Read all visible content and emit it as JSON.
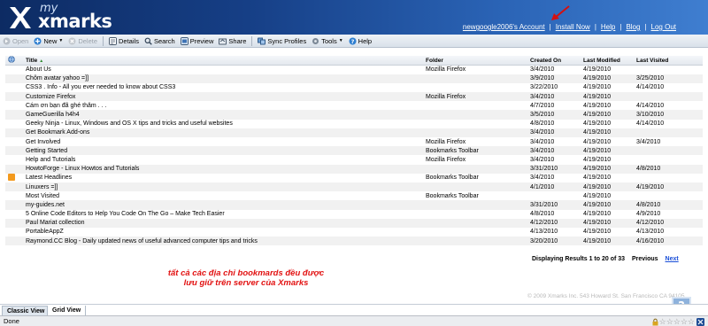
{
  "brand": {
    "my": "my",
    "name": "xmarks"
  },
  "top_links": [
    "newgoogle2006's Account",
    "Install Now",
    "Help",
    "Blog",
    "Log Out"
  ],
  "toolbar": {
    "open": "Open",
    "new": "New",
    "delete": "Delete",
    "details": "Details",
    "search": "Search",
    "preview": "Preview",
    "share": "Share",
    "sync_profiles": "Sync Profiles",
    "tools": "Tools",
    "help": "Help"
  },
  "table": {
    "headers": {
      "title": "Title",
      "folder": "Folder",
      "created": "Created On",
      "modified": "Last Modified",
      "visited": "Last Visited"
    },
    "rows": [
      {
        "title": "About Us",
        "folder": "Mozilla Firefox",
        "created": "3/4/2010",
        "modified": "4/19/2010",
        "visited": ""
      },
      {
        "title": "Chôm avatar yahoo =]]",
        "folder": "",
        "created": "3/9/2010",
        "modified": "4/19/2010",
        "visited": "3/25/2010"
      },
      {
        "title": "CSS3 . Info - All you ever needed to know about CSS3",
        "folder": "",
        "created": "3/22/2010",
        "modified": "4/19/2010",
        "visited": "4/14/2010"
      },
      {
        "title": "Customize Firefox",
        "folder": "Mozilla Firefox",
        "created": "3/4/2010",
        "modified": "4/19/2010",
        "visited": ""
      },
      {
        "title": "Cám ơn bạn đã ghé thăm . . .",
        "folder": "",
        "created": "4/7/2010",
        "modified": "4/19/2010",
        "visited": "4/14/2010"
      },
      {
        "title": "GameGuerilla h4h4",
        "folder": "",
        "created": "3/5/2010",
        "modified": "4/19/2010",
        "visited": "3/10/2010"
      },
      {
        "title": "Geeky Ninja - Linux, Windows and OS X tips and tricks and useful websites",
        "folder": "",
        "created": "4/8/2010",
        "modified": "4/19/2010",
        "visited": "4/14/2010"
      },
      {
        "title": "Get Bookmark Add-ons",
        "folder": "",
        "created": "3/4/2010",
        "modified": "4/19/2010",
        "visited": ""
      },
      {
        "title": "Get Involved",
        "folder": "Mozilla Firefox",
        "created": "3/4/2010",
        "modified": "4/19/2010",
        "visited": "3/4/2010"
      },
      {
        "title": "Getting Started",
        "folder": "Bookmarks Toolbar",
        "created": "3/4/2010",
        "modified": "4/19/2010",
        "visited": ""
      },
      {
        "title": "Help and Tutorials",
        "folder": "Mozilla Firefox",
        "created": "3/4/2010",
        "modified": "4/19/2010",
        "visited": ""
      },
      {
        "title": "HowtoForge - Linux Howtos and Tutorials",
        "folder": "",
        "created": "3/31/2010",
        "modified": "4/19/2010",
        "visited": "4/8/2010"
      },
      {
        "title": "Latest Headlines",
        "folder": "Bookmarks Toolbar",
        "created": "3/4/2010",
        "modified": "4/19/2010",
        "visited": "",
        "rss": true
      },
      {
        "title": "Linuxers =]]",
        "folder": "",
        "created": "4/1/2010",
        "modified": "4/19/2010",
        "visited": "4/19/2010"
      },
      {
        "title": "Most Visited",
        "folder": "Bookmarks Toolbar",
        "created": "",
        "modified": "4/19/2010",
        "visited": ""
      },
      {
        "title": "my-guides.net",
        "folder": "",
        "created": "3/31/2010",
        "modified": "4/19/2010",
        "visited": "4/8/2010"
      },
      {
        "title": "5 Online Code Editors to Help You Code On The Go – Make Tech Easier",
        "folder": "",
        "created": "4/8/2010",
        "modified": "4/19/2010",
        "visited": "4/9/2010"
      },
      {
        "title": "Paul Mariat collection",
        "folder": "",
        "created": "4/12/2010",
        "modified": "4/19/2010",
        "visited": "4/12/2010"
      },
      {
        "title": "PortableAppZ",
        "folder": "",
        "created": "4/13/2010",
        "modified": "4/19/2010",
        "visited": "4/13/2010"
      },
      {
        "title": "Raymond.CC Blog - Daily updated news of useful advanced computer tips and tricks",
        "folder": "",
        "created": "3/20/2010",
        "modified": "4/19/2010",
        "visited": "4/16/2010"
      }
    ]
  },
  "pager": {
    "text": "Displaying Results 1 to 20 of 33",
    "previous": "Previous",
    "next": "Next"
  },
  "annotation": {
    "line1": "tất cả các địa chỉ bookmards đều được",
    "line2": "lưu giữ trên server của Xmarks"
  },
  "footer": "© 2009 Xmarks Inc.   543 Howard St. San Francisco CA 94105",
  "tabs": {
    "classic": "Classic View",
    "grid": "Grid View"
  },
  "status": {
    "text": "Done"
  }
}
